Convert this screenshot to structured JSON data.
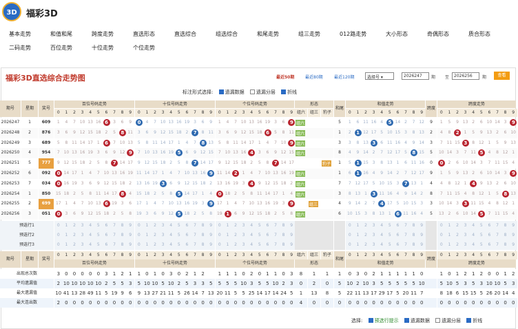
{
  "brand": "福彩3D",
  "logo_text": "3D",
  "nav": {
    "row1": [
      "基本走势",
      "和值和尾",
      "跨度走势",
      "直选形态",
      "直选综合",
      "组选综合",
      "和尾走势",
      "组三走势",
      "012路走势",
      "大小形态",
      "奇偶形态",
      "质合形态"
    ],
    "row2": [
      "二码走势",
      "百位走势",
      "十位走势",
      "个位走势"
    ]
  },
  "panel": {
    "title": "福彩3D直选综合走势图",
    "recent": [
      "最近50期",
      "最近80期",
      "最近120期"
    ],
    "select_label": "选择号",
    "from": "2026247",
    "to": "2026256",
    "qi1": "期",
    "zhi": "至",
    "qi2": "期",
    "query": "查看"
  },
  "options": {
    "label": "标注形式选择:",
    "items": [
      "遗漏数据",
      "遗漏分层",
      "折线"
    ]
  },
  "headers": {
    "qihao": "期号",
    "xingqi": "星期",
    "jianghao": "奖号",
    "bai": "百位号码走势",
    "shi": "十位号码走势",
    "ge": "个位号码走势",
    "xingtai": "形态",
    "hewei": "和尾",
    "hezhi": "和值走势",
    "kuadu": "跨度",
    "kuadu2": "跨度走势",
    "zu6": "组六",
    "zu3": "组三",
    "baozi": "豹子",
    "digits": [
      "0",
      "1",
      "2",
      "3",
      "4",
      "5",
      "6",
      "7",
      "8",
      "9"
    ]
  },
  "rows": [
    {
      "qi": "2026247",
      "wk": "1",
      "hao": "609"
    },
    {
      "qi": "2026248",
      "wk": "2",
      "hao": "876"
    },
    {
      "qi": "2026249",
      "wk": "3",
      "hao": "689"
    },
    {
      "qi": "2026250",
      "wk": "4",
      "hao": "954"
    },
    {
      "qi": "2026251",
      "wk": "5",
      "hao": "777"
    },
    {
      "qi": "2026252",
      "wk": "6",
      "hao": "092"
    },
    {
      "qi": "2026253",
      "wk": "7",
      "hao": "034"
    },
    {
      "qi": "2026254",
      "wk": "1",
      "hao": "850"
    },
    {
      "qi": "2026255",
      "wk": "2",
      "hao": "699"
    },
    {
      "qi": "2026256",
      "wk": "3",
      "hao": "051"
    }
  ],
  "forecast": [
    "预选行1",
    "预选行2",
    "预选行3"
  ],
  "stats": [
    {
      "label": "出现总次数",
      "bai": "3 0 0 0 0 0 3 1 2 1",
      "shi": "1 0 1 0 3 0 2 1 2",
      "ge": "1 1 1 0 2 0 1 1 0 3",
      "xt": "8 1 1",
      "hw": "1",
      "hz": "0 3 0 2 1 1 1 1 1 0",
      "kd": "1 0 1 2 1 2 0 0 1 2"
    },
    {
      "label": "平均遗漏值",
      "bai": "2 10 10 10 10 10 2 5 5 3",
      "shi": "5 10 10 5 10 2 5 3 3 5",
      "ge": "5 5 5 10 3 5 5 10 2 3",
      "xt": "0 2 0",
      "hw": "5",
      "hz": "10 2 10 3 5 5 5 5 5 10",
      "kd": "5 10 5 3 5 3 10 10 5 3"
    },
    {
      "label": "最大遗漏值",
      "bai": "10 41 13 28 49 11 5 19 9 6",
      "shi": "9 13 27 21 11 5 26 14 7 13",
      "ge": "20 11 5 5 25 14 17 14 24 5",
      "xt": "1 13 8",
      "hw": "5",
      "hz": "22 11 13 17 29 17 5 20 11 7",
      "kd": "8 18 6 15 15 5 26 20 14 4"
    },
    {
      "label": "最大连出数",
      "bai": "2 0 0 0 0 0 0 0 0 0",
      "shi": "0 0 0 0 0 0 0 0 0 0",
      "ge": "0 0 0 0 0 0 0 0 0 0",
      "xt": "4 0 0",
      "hw": "0",
      "hz": "0 0 0 0 0 0 0 0 0 0",
      "kd": "0 0 0 0 0 0 0 0 0 0"
    }
  ],
  "bottom": {
    "label": "选择:",
    "items": [
      "预选行提示",
      "遗漏数据",
      "遗漏分层",
      "折线"
    ]
  },
  "colors": {
    "hit_red": "#b8242f",
    "hit_blue": "#2f6ab0",
    "accent": "#c0392b"
  }
}
